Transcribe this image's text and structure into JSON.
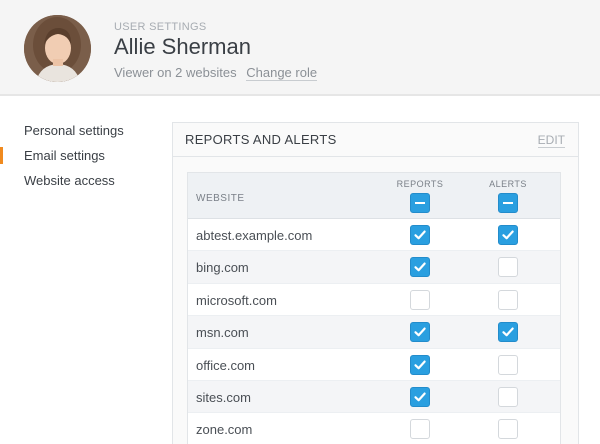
{
  "user": {
    "eyebrow": "USER SETTINGS",
    "name": "Allie Sherman",
    "role_text": "Viewer on 2 websites",
    "change_role": "Change role"
  },
  "sidebar": {
    "items": [
      {
        "label": "Personal settings",
        "active": false
      },
      {
        "label": "Email settings",
        "active": true
      },
      {
        "label": "Website access",
        "active": false
      }
    ]
  },
  "panel": {
    "title": "REPORTS AND ALERTS",
    "edit": "EDIT"
  },
  "table": {
    "col_site": "WEBSITE",
    "col_reports": "REPORTS",
    "col_alerts": "ALERTS",
    "rows": [
      {
        "site": "abtest.example.com",
        "reports": true,
        "alerts": true
      },
      {
        "site": "bing.com",
        "reports": true,
        "alerts": false
      },
      {
        "site": "microsoft.com",
        "reports": false,
        "alerts": false
      },
      {
        "site": "msn.com",
        "reports": true,
        "alerts": true
      },
      {
        "site": "office.com",
        "reports": true,
        "alerts": false
      },
      {
        "site": "sites.com",
        "reports": true,
        "alerts": false
      },
      {
        "site": "zone.com",
        "reports": false,
        "alerts": false
      }
    ]
  },
  "colors": {
    "accent": "#2a9fe0",
    "active_marker": "#f08a1f"
  }
}
